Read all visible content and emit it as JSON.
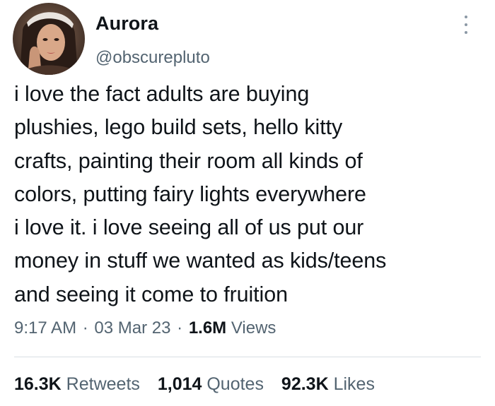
{
  "tweet": {
    "author": {
      "display_name": "Aurora",
      "handle": "@obscurepluto"
    },
    "text_lines": [
      "i love the fact adults are buying",
      "plushies, lego build sets, hello kitty",
      "crafts, painting their room all kinds of",
      "colors, putting fairy lights everywhere",
      "i love it. i love seeing all of us put our",
      "money in stuff we wanted as kids/teens",
      "and seeing it come to fruition"
    ],
    "meta": {
      "time": "9:17 AM",
      "separator": "·",
      "date": "03 Mar 23",
      "views_count": "1.6M",
      "views_label": "Views"
    },
    "stats": {
      "retweets_count": "16.3K",
      "retweets_label": "Retweets",
      "quotes_count": "1,014",
      "quotes_label": "Quotes",
      "likes_count": "92.3K",
      "likes_label": "Likes"
    }
  },
  "icons": {
    "more": "more-vertical-icon",
    "avatar": "profile-photo"
  },
  "colors": {
    "primary_text": "#0f1419",
    "secondary_text": "#536471",
    "divider": "#d8dee3",
    "background": "#ffffff"
  }
}
